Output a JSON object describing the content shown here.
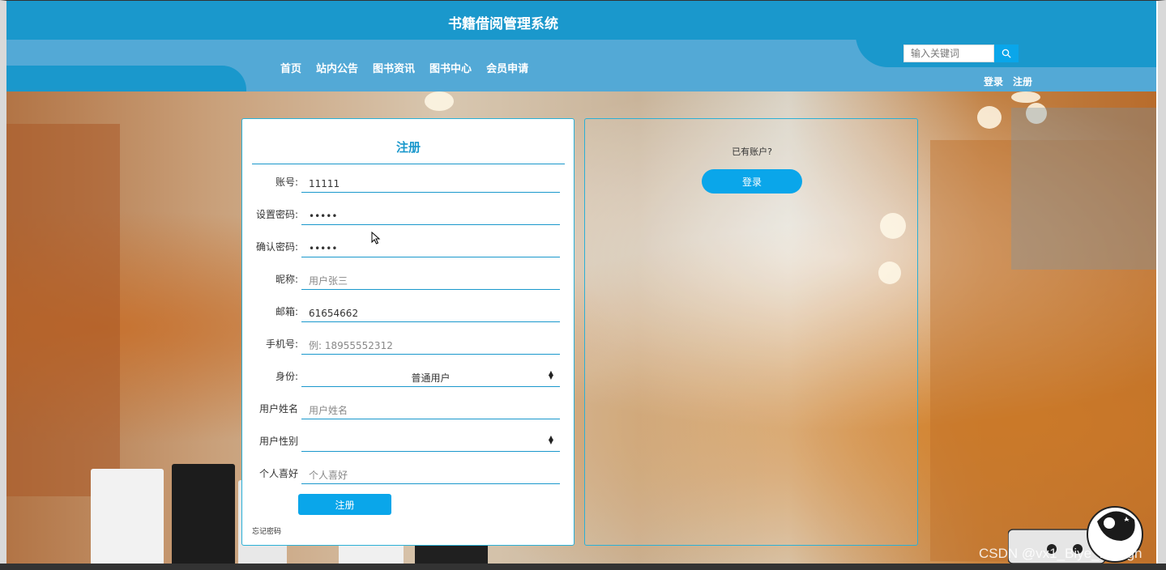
{
  "header": {
    "site_title": "书籍借阅管理系统",
    "nav": [
      "首页",
      "站内公告",
      "图书资讯",
      "图书中心",
      "会员申请"
    ],
    "search_placeholder": "输入关键词",
    "login_link": "登录",
    "register_link": "注册"
  },
  "register_form": {
    "title": "注册",
    "fields": [
      {
        "label": "账号:",
        "value": "11111",
        "placeholder": ""
      },
      {
        "label": "设置密码:",
        "value": "•••••",
        "placeholder": ""
      },
      {
        "label": "确认密码:",
        "value": "•••••",
        "placeholder": ""
      },
      {
        "label": "昵称:",
        "value": "",
        "placeholder": "用户张三"
      },
      {
        "label": "邮箱:",
        "value": "61654662",
        "placeholder": ""
      },
      {
        "label": "手机号:",
        "value": "",
        "placeholder": "例: 18955552312"
      },
      {
        "label": "身份:",
        "value": "普通用户"
      },
      {
        "label": "用户姓名",
        "value": "",
        "placeholder": "用户姓名"
      },
      {
        "label": "用户性别",
        "value": ""
      },
      {
        "label": "个人喜好",
        "value": "",
        "placeholder": "个人喜好"
      }
    ],
    "submit_label": "注册",
    "forgot_label": "忘记密码"
  },
  "login_panel": {
    "prompt": "已有账户?",
    "button_label": "登录"
  },
  "watermark": "CSDN @vx1_Biye_Design",
  "colors": {
    "header_dark": "#1a98cc",
    "header_light": "#53a9d6",
    "accent": "#0aa6ea"
  }
}
